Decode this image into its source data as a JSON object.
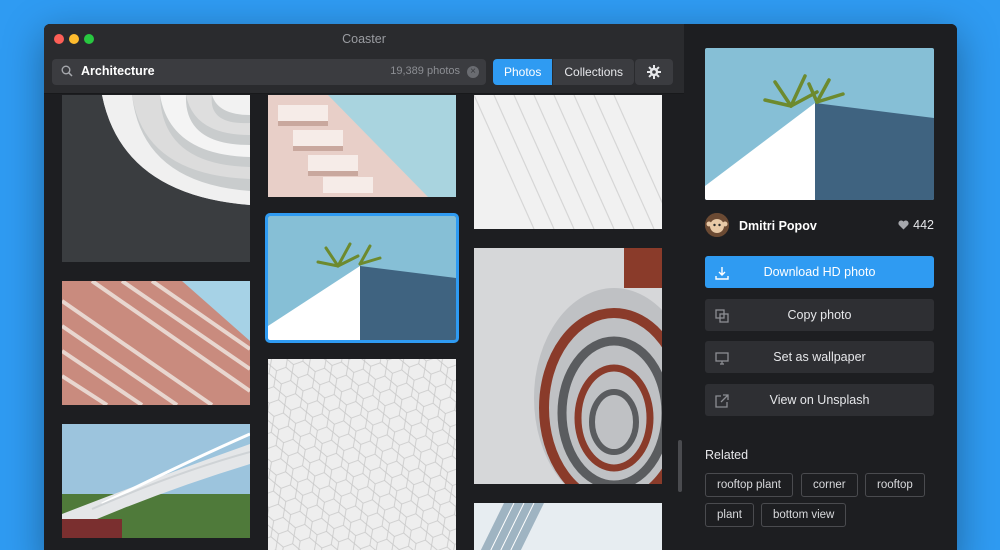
{
  "window": {
    "title": "Coaster"
  },
  "search": {
    "query": "Architecture",
    "count": "19,389 photos"
  },
  "tabs": [
    {
      "label": "Photos",
      "active": true
    },
    {
      "label": "Collections",
      "active": false
    }
  ],
  "photo": {
    "author": "Dmitri Popov",
    "likes": "442"
  },
  "actions": [
    {
      "label": "Download HD photo",
      "icon": "download-icon"
    },
    {
      "label": "Copy photo",
      "icon": "copy-icon"
    },
    {
      "label": "Set as wallpaper",
      "icon": "monitor-icon"
    },
    {
      "label": "View on Unsplash",
      "icon": "external-link-icon"
    }
  ],
  "related": {
    "title": "Related",
    "tags": [
      "rooftop plant",
      "corner",
      "rooftop",
      "plant",
      "bottom view"
    ]
  },
  "colors": {
    "accent": "#2f9bf2",
    "background": "#1d1e21",
    "panel": "#2a2b2e"
  }
}
